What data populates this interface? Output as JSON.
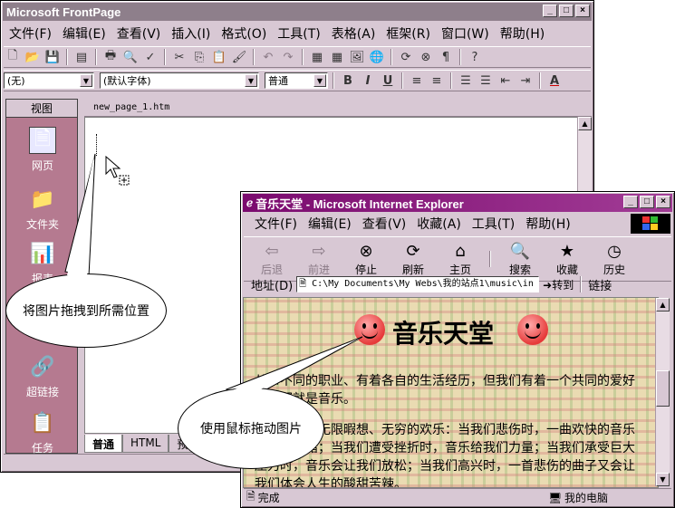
{
  "frontpage": {
    "title": "Microsoft FrontPage",
    "menu": [
      "文件(F)",
      "编辑(E)",
      "查看(V)",
      "插入(I)",
      "格式(O)",
      "工具(T)",
      "表格(A)",
      "框架(R)",
      "窗口(W)",
      "帮助(H)"
    ],
    "format": {
      "style": "(无)",
      "font": "(默认字体)",
      "size": "普通"
    },
    "view_pane": {
      "header": "视图",
      "items": [
        "网页",
        "文件夹",
        "报表",
        "超链接",
        "任务"
      ]
    },
    "doc_tab": "new_page_1.htm",
    "view_tabs": [
      "普通",
      "HTML",
      "预览"
    ]
  },
  "ie": {
    "title": "音乐天堂 - Microsoft Internet Explorer",
    "menu": [
      "文件(F)",
      "编辑(E)",
      "查看(V)",
      "收藏(A)",
      "工具(T)",
      "帮助(H)"
    ],
    "toolbar": [
      "后退",
      "前进",
      "停止",
      "刷新",
      "主页",
      "搜索",
      "收藏",
      "历史"
    ],
    "address_label": "地址(D)",
    "address": "C:\\My Documents\\My Webs\\我的站点1\\music\\in",
    "go_label": "转到",
    "links_label": "链接",
    "page": {
      "heading": "音乐天堂",
      "para1": "从事不同的职业、有着各自的生活经历，但我们有着一个共同的爱好——那就是音乐。",
      "para2": "音乐给我们无限暇想、无穷的欢乐：当我们悲伤时，一曲欢快的音乐会缓解情绪；当我们遭受挫折时，音乐给我们力量；当我们承受巨大压力时，音乐会让我们放松；当我们高兴时，一首悲伤的曲子又会让我们体会人生的酸甜苦辣。"
    },
    "status_left": "完成",
    "status_right": "我的电脑"
  },
  "callouts": {
    "drag_to_position": "将图片拖拽到所需位置",
    "drag_with_mouse": "使用鼠标拖动图片"
  }
}
